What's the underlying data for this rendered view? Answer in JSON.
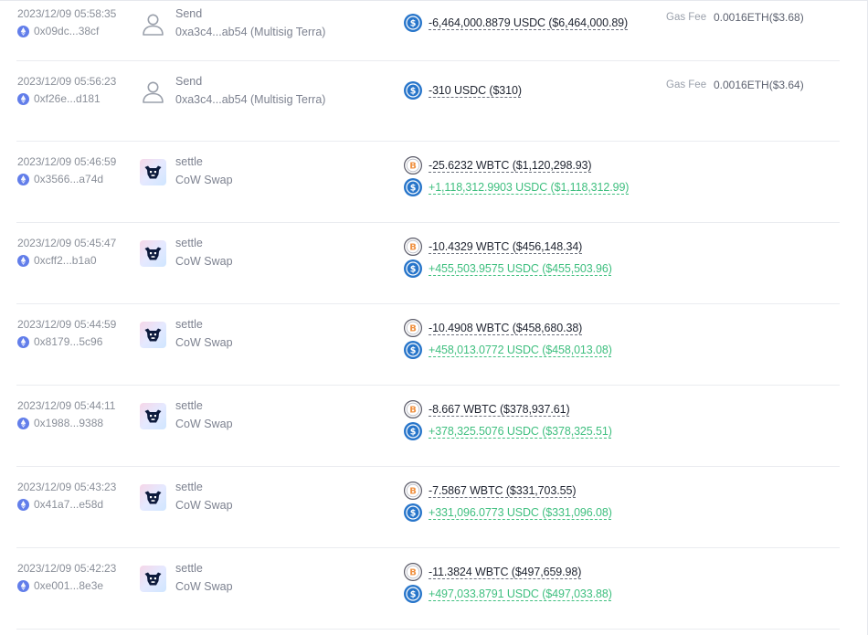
{
  "gas_fee_label": "Gas Fee",
  "colors": {
    "positive": "#3fbf7f",
    "negative": "#1f2430",
    "usdc": "#2775ca",
    "wbtc": "#f09242",
    "eth": "#627eea"
  },
  "transactions": [
    {
      "time": "2023/12/09 05:58:35",
      "hash": "0x09dc...38cf",
      "icon": "user-icon",
      "action": "Send",
      "counterparty": "0xa3c4...ab54 (Multisig Terra)",
      "tokens": [
        {
          "icon": "usdc-icon",
          "amount": "-6,464,000.8879 USDC ($6,464,000.89)",
          "direction": "out"
        }
      ],
      "gas_fee": "0.0016ETH($3.68)"
    },
    {
      "time": "2023/12/09 05:56:23",
      "hash": "0xf26e...d181",
      "icon": "user-icon",
      "action": "Send",
      "counterparty": "0xa3c4...ab54 (Multisig Terra)",
      "tokens": [
        {
          "icon": "usdc-icon",
          "amount": "-310 USDC ($310)",
          "direction": "out"
        }
      ],
      "gas_fee": "0.0016ETH($3.64)"
    },
    {
      "time": "2023/12/09 05:46:59",
      "hash": "0x3566...a74d",
      "icon": "cow-swap-icon",
      "action": "settle",
      "counterparty": "CoW Swap",
      "tokens": [
        {
          "icon": "wbtc-icon",
          "amount": "-25.6232 WBTC ($1,120,298.93)",
          "direction": "out"
        },
        {
          "icon": "usdc-icon",
          "amount": "+1,118,312.9903 USDC ($1,118,312.99)",
          "direction": "in"
        }
      ],
      "gas_fee": ""
    },
    {
      "time": "2023/12/09 05:45:47",
      "hash": "0xcff2...b1a0",
      "icon": "cow-swap-icon",
      "action": "settle",
      "counterparty": "CoW Swap",
      "tokens": [
        {
          "icon": "wbtc-icon",
          "amount": "-10.4329 WBTC ($456,148.34)",
          "direction": "out"
        },
        {
          "icon": "usdc-icon",
          "amount": "+455,503.9575 USDC ($455,503.96)",
          "direction": "in"
        }
      ],
      "gas_fee": ""
    },
    {
      "time": "2023/12/09 05:44:59",
      "hash": "0x8179...5c96",
      "icon": "cow-swap-icon",
      "action": "settle",
      "counterparty": "CoW Swap",
      "tokens": [
        {
          "icon": "wbtc-icon",
          "amount": "-10.4908 WBTC ($458,680.38)",
          "direction": "out"
        },
        {
          "icon": "usdc-icon",
          "amount": "+458,013.0772 USDC ($458,013.08)",
          "direction": "in"
        }
      ],
      "gas_fee": ""
    },
    {
      "time": "2023/12/09 05:44:11",
      "hash": "0x1988...9388",
      "icon": "cow-swap-icon",
      "action": "settle",
      "counterparty": "CoW Swap",
      "tokens": [
        {
          "icon": "wbtc-icon",
          "amount": "-8.667 WBTC ($378,937.61)",
          "direction": "out"
        },
        {
          "icon": "usdc-icon",
          "amount": "+378,325.5076 USDC ($378,325.51)",
          "direction": "in"
        }
      ],
      "gas_fee": ""
    },
    {
      "time": "2023/12/09 05:43:23",
      "hash": "0x41a7...e58d",
      "icon": "cow-swap-icon",
      "action": "settle",
      "counterparty": "CoW Swap",
      "tokens": [
        {
          "icon": "wbtc-icon",
          "amount": "-7.5867 WBTC ($331,703.55)",
          "direction": "out"
        },
        {
          "icon": "usdc-icon",
          "amount": "+331,096.0773 USDC ($331,096.08)",
          "direction": "in"
        }
      ],
      "gas_fee": ""
    },
    {
      "time": "2023/12/09 05:42:23",
      "hash": "0xe001...8e3e",
      "icon": "cow-swap-icon",
      "action": "settle",
      "counterparty": "CoW Swap",
      "tokens": [
        {
          "icon": "wbtc-icon",
          "amount": "-11.3824 WBTC ($497,659.98)",
          "direction": "out"
        },
        {
          "icon": "usdc-icon",
          "amount": "+497,033.8791 USDC ($497,033.88)",
          "direction": "in"
        }
      ],
      "gas_fee": ""
    }
  ]
}
